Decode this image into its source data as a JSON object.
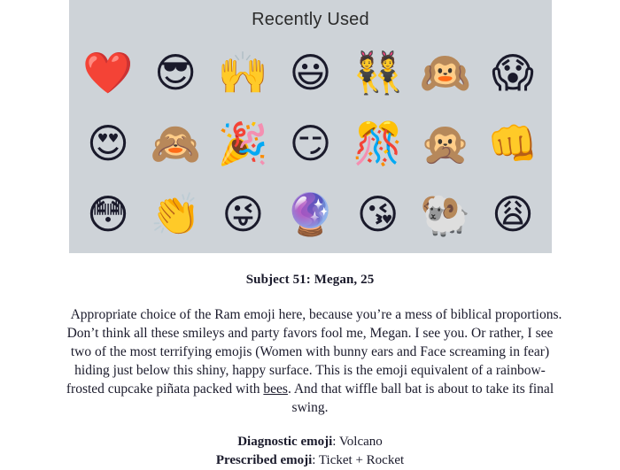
{
  "emoji_panel": {
    "title": "Recently Used",
    "background_color": "#ced3d8",
    "rows": [
      [
        {
          "name": "red-heart",
          "glyph": "❤️"
        },
        {
          "name": "smiling-face-with-sunglasses",
          "glyph": "😎"
        },
        {
          "name": "raising-hands",
          "glyph": "🙌"
        },
        {
          "name": "grinning-face-with-big-eyes",
          "glyph": "😃"
        },
        {
          "name": "women-with-bunny-ears",
          "glyph": "👯"
        },
        {
          "name": "hear-no-evil-monkey",
          "glyph": "🙉"
        },
        {
          "name": "face-screaming-in-fear",
          "glyph": "😱"
        }
      ],
      [
        {
          "name": "smiling-face-with-heart-eyes",
          "glyph": "😍"
        },
        {
          "name": "see-no-evil-monkey",
          "glyph": "🙈"
        },
        {
          "name": "party-popper",
          "glyph": "🎉"
        },
        {
          "name": "smirking-face",
          "glyph": "😏"
        },
        {
          "name": "confetti-ball",
          "glyph": "🎊"
        },
        {
          "name": "speak-no-evil-monkey",
          "glyph": "🙊"
        },
        {
          "name": "oncoming-fist",
          "glyph": "👊"
        }
      ],
      [
        {
          "name": "flushed-face",
          "glyph": "😳"
        },
        {
          "name": "clapping-hands",
          "glyph": "👏"
        },
        {
          "name": "winking-face-with-tongue",
          "glyph": "😜"
        },
        {
          "name": "crystal-ball",
          "glyph": "🔮"
        },
        {
          "name": "face-blowing-a-kiss",
          "glyph": "😘"
        },
        {
          "name": "ram",
          "glyph": "🐏"
        },
        {
          "name": "weary-face",
          "glyph": "😩"
        }
      ]
    ]
  },
  "article": {
    "subject_heading": "Subject 51: Megan, 25",
    "body": {
      "part1": "Appropriate choice of the Ram emoji here, because you’re a mess of biblical proportions. Don’t think all these smileys and party favors fool me, Megan. I see you. Or rather, I see two of the most terrifying emojis (Women with bunny ears and Face screaming in fear) hiding just below this shiny, happy surface. This is the emoji equivalent of a rainbow-frosted cupcake piñata packed with ",
      "link_text": "bees",
      "part2": ". And that wiffle ball bat is about to take its final swing."
    },
    "footer": {
      "diagnostic_label": "Diagnostic emoji",
      "diagnostic_value": ": Volcano",
      "prescribed_label": "Prescribed emoji",
      "prescribed_value": ": Ticket + Rocket"
    }
  }
}
